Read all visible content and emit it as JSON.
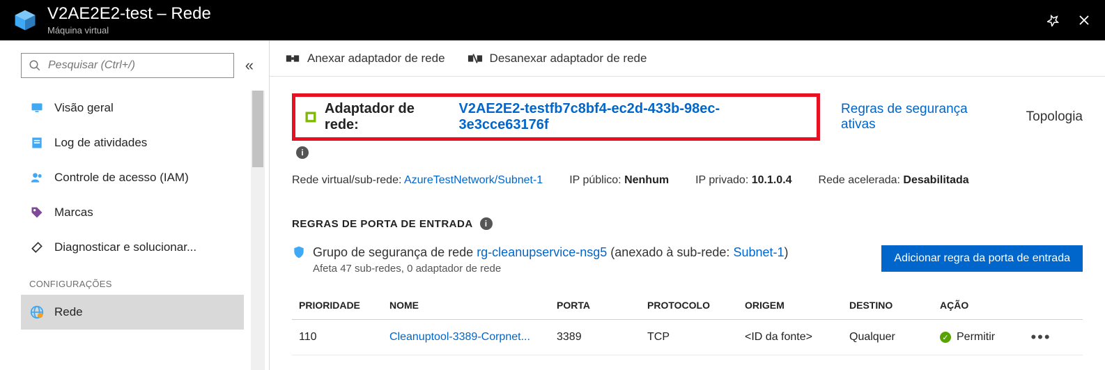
{
  "header": {
    "title": "V2AE2E2-test – Rede",
    "subtitle": "Máquina virtual"
  },
  "sidebar": {
    "search_placeholder": "Pesquisar (Ctrl+/)",
    "items": [
      {
        "label": "Visão geral",
        "icon": "monitor"
      },
      {
        "label": "Log de atividades",
        "icon": "log"
      },
      {
        "label": "Controle de acesso (IAM)",
        "icon": "people"
      },
      {
        "label": "Marcas",
        "icon": "tag"
      },
      {
        "label": "Diagnosticar e solucionar...",
        "icon": "tools"
      }
    ],
    "section_label": "CONFIGURAÇÕES",
    "config_items": [
      {
        "label": "Rede",
        "icon": "network",
        "selected": true
      }
    ]
  },
  "toolbar": {
    "attach_label": "Anexar adaptador de rede",
    "detach_label": "Desanexar adaptador de rede"
  },
  "adapter": {
    "label": "Adaptador de rede:",
    "name": "V2AE2E2-testfb7c8bf4-ec2d-433b-98ec-3e3cce63176f",
    "active_rules_link": "Regras de segurança ativas",
    "topology_link": "Topologia"
  },
  "meta": {
    "vnet_label": "Rede virtual/sub-rede:",
    "vnet_value": "AzureTestNetwork/Subnet-1",
    "public_ip_label": "IP público:",
    "public_ip_value": "Nenhum",
    "private_ip_label": "IP privado:",
    "private_ip_value": "10.1.0.4",
    "accel_label": "Rede acelerada:",
    "accel_value": "Desabilitada"
  },
  "rules": {
    "inbound_header": "REGRAS DE PORTA DE ENTRADA",
    "nsg_prefix": "Grupo de segurança de rede",
    "nsg_name": "rg-cleanupservice-nsg5",
    "nsg_suffix1": "(anexado à sub-rede:",
    "nsg_subnet": "Subnet-1",
    "nsg_suffix2": ")",
    "nsg_note": "Afeta 47 sub-redes, 0 adaptador de rede",
    "add_button": "Adicionar regra da porta de entrada",
    "columns": {
      "priority": "PRIORIDADE",
      "name": "NOME",
      "port": "PORTA",
      "protocol": "PROTOCOLO",
      "source": "ORIGEM",
      "destination": "DESTINO",
      "action": "AÇÃO"
    },
    "rows": [
      {
        "priority": "110",
        "name": "Cleanuptool-3389-Corpnet...",
        "port": "3389",
        "protocol": "TCP",
        "source": "<ID da fonte>",
        "destination": "Qualquer",
        "action": "Permitir"
      }
    ]
  }
}
